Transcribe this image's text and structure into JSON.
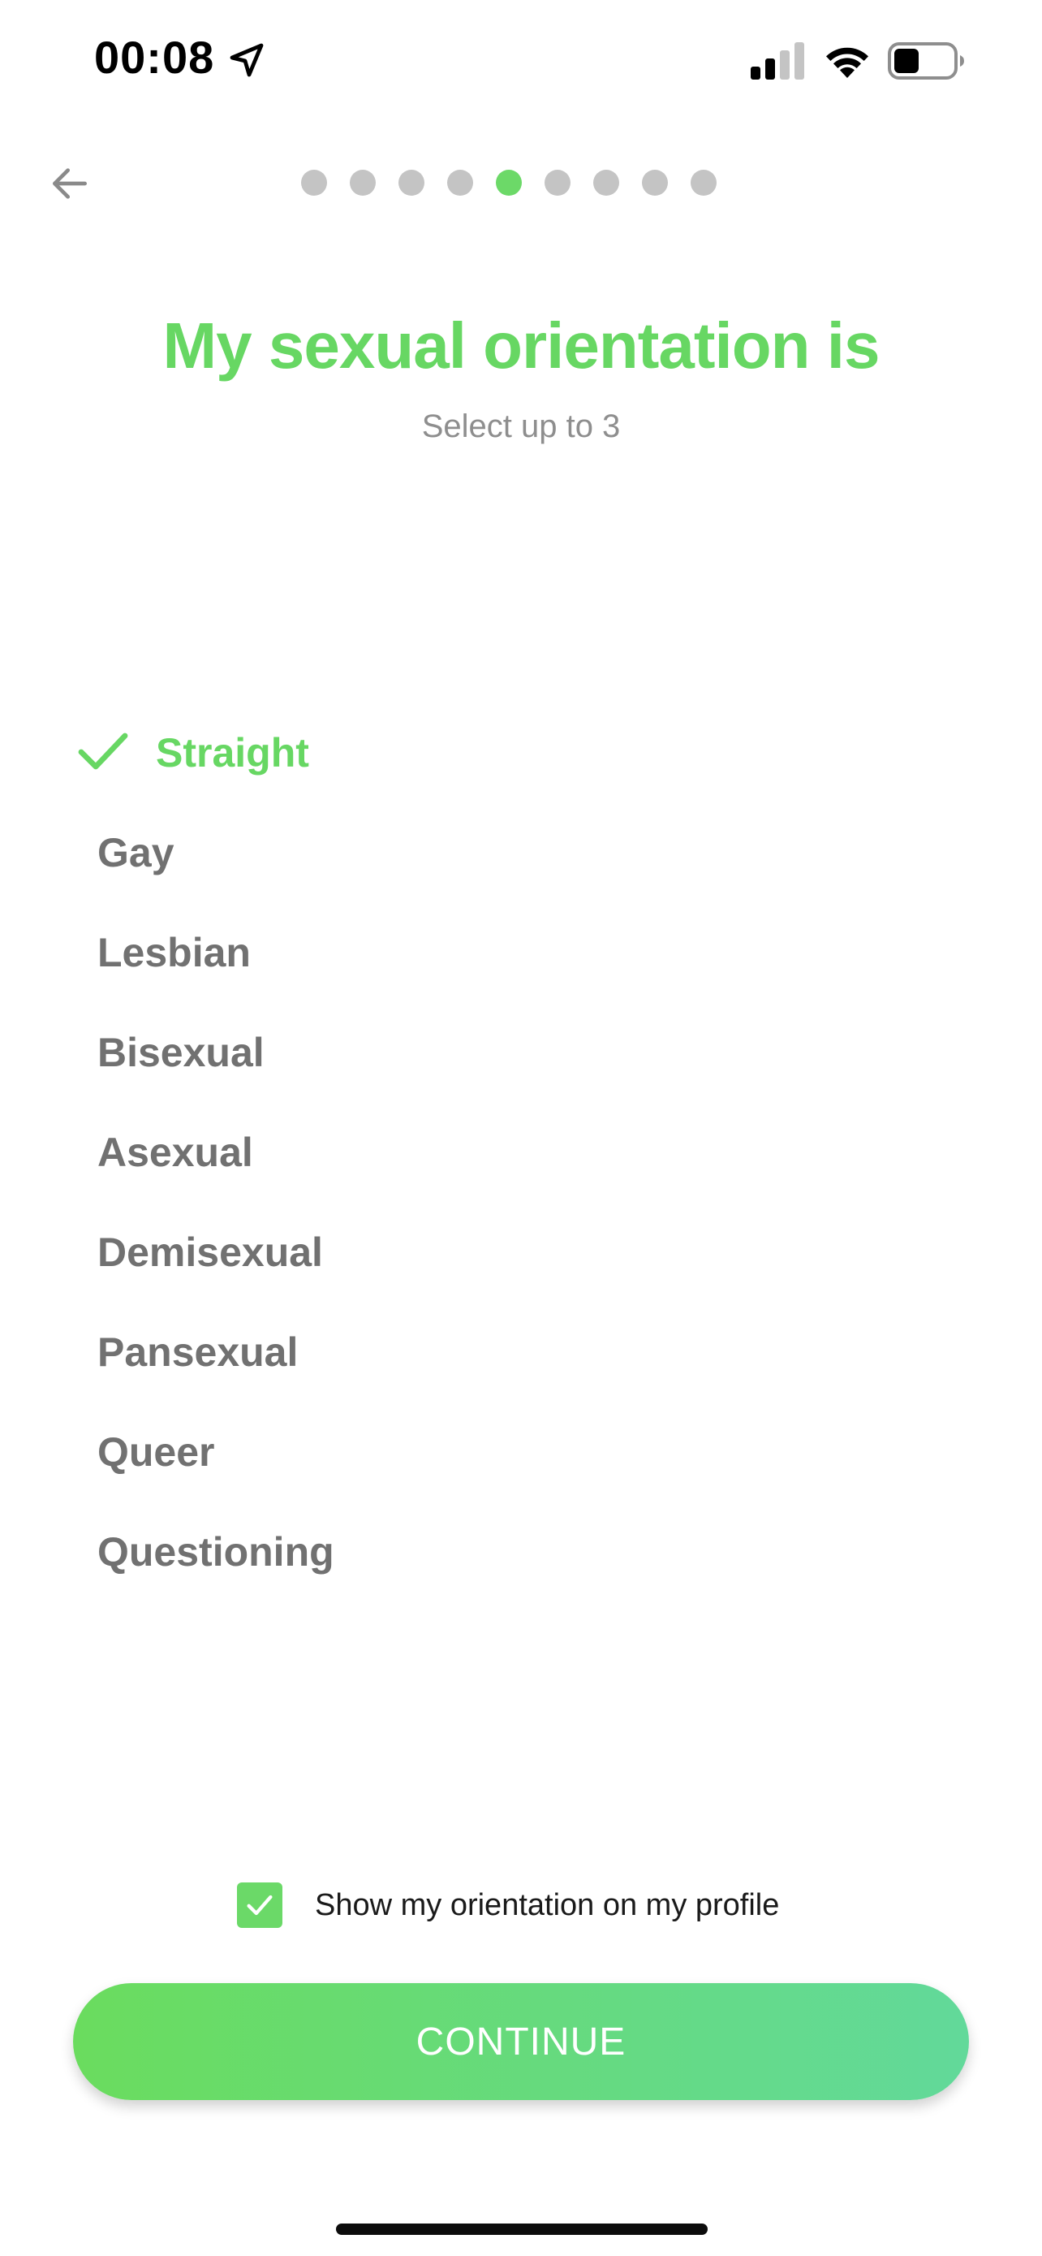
{
  "status_bar": {
    "time": "00:08",
    "icons": [
      "location-arrow-icon",
      "cellular-signal-icon",
      "wifi-icon",
      "battery-icon"
    ]
  },
  "navigation": {
    "back_icon": "arrow-left-icon",
    "progress": {
      "total_steps": 9,
      "current_step": 5
    }
  },
  "header": {
    "title": "My sexual orientation is",
    "subtitle": "Select up to 3"
  },
  "options": [
    {
      "label": "Straight",
      "selected": true
    },
    {
      "label": "Gay",
      "selected": false
    },
    {
      "label": "Lesbian",
      "selected": false
    },
    {
      "label": "Bisexual",
      "selected": false
    },
    {
      "label": "Asexual",
      "selected": false
    },
    {
      "label": "Demisexual",
      "selected": false
    },
    {
      "label": "Pansexual",
      "selected": false
    },
    {
      "label": "Queer",
      "selected": false
    },
    {
      "label": "Questioning",
      "selected": false
    }
  ],
  "show_on_profile": {
    "label": "Show my orientation on my profile",
    "checked": true
  },
  "continue_button": {
    "label": "CONTINUE"
  },
  "colors": {
    "accent": "#67d763",
    "gradient_start": "#6adc5e",
    "gradient_end": "#62d99a",
    "unselected_text": "#717171",
    "inactive_dot": "#c4c4c4"
  }
}
